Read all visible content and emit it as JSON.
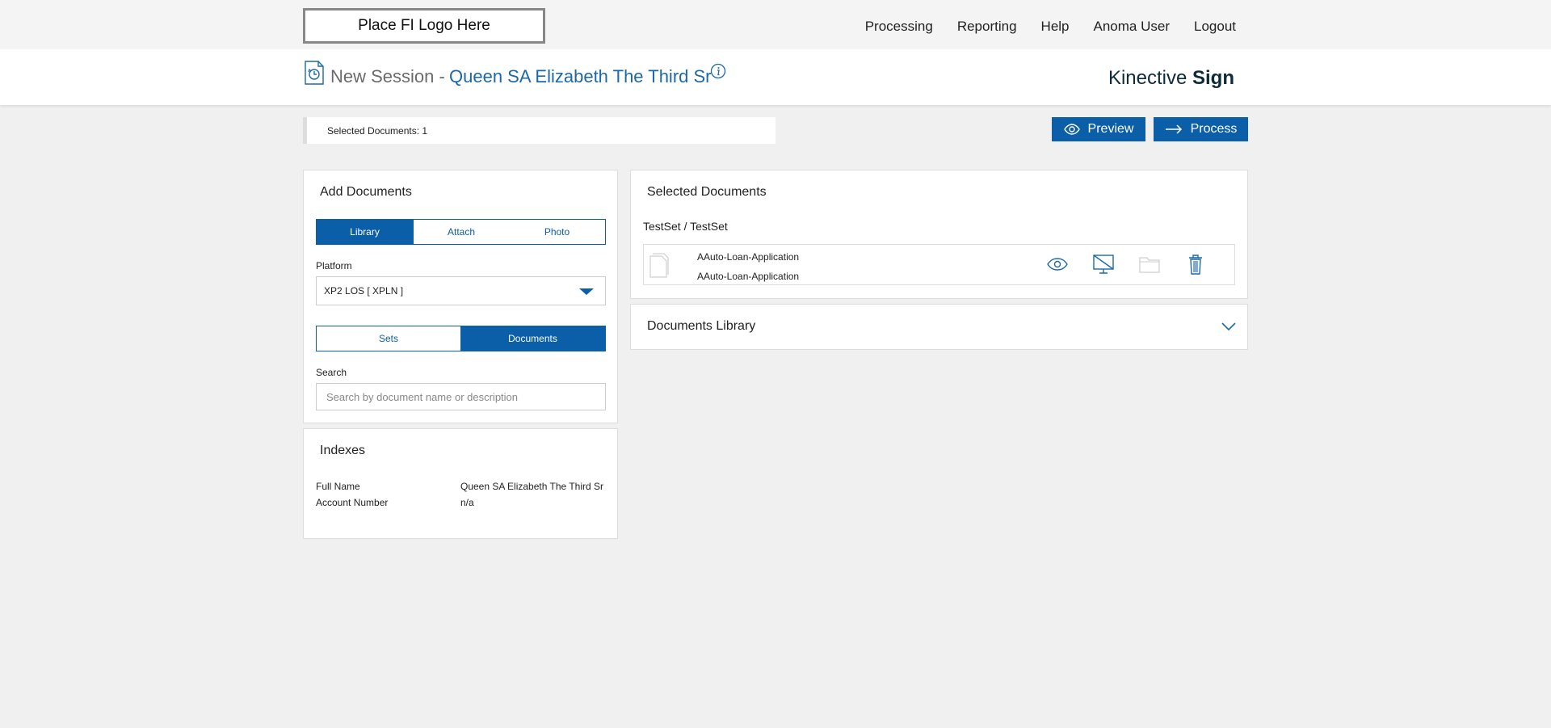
{
  "header": {
    "logo_text": "Place FI Logo Here",
    "nav": [
      "Processing",
      "Reporting",
      "Help",
      "Anoma User",
      "Logout"
    ]
  },
  "session": {
    "title": "New Session -",
    "name": "Queen SA Elizabeth The Third Sr",
    "brand_light": "Kinective",
    "brand_bold": "Sign"
  },
  "toolbar": {
    "selected_count_text": "Selected Documents: 1",
    "preview_label": "Preview",
    "process_label": "Process"
  },
  "add_documents": {
    "title": "Add Documents",
    "source_tabs": [
      "Library",
      "Attach",
      "Photo"
    ],
    "active_source": "Library",
    "platform_label": "Platform",
    "platform_value": "XP2 LOS [ XPLN ]",
    "view_tabs": [
      "Sets",
      "Documents"
    ],
    "active_view": "Documents",
    "search_label": "Search",
    "search_placeholder": "Search by document name or description"
  },
  "indexes": {
    "title": "Indexes",
    "rows": [
      {
        "label": "Full Name",
        "value": "Queen SA Elizabeth The Third Sr"
      },
      {
        "label": "Account Number",
        "value": "n/a"
      }
    ]
  },
  "selected_documents": {
    "title": "Selected Documents",
    "set_name": "TestSet / TestSet",
    "documents": [
      {
        "name": "AAuto-Loan-Application",
        "description": "AAuto-Loan-Application"
      }
    ]
  },
  "documents_library": {
    "title": "Documents Library"
  },
  "colors": {
    "accent": "#0b5ea8",
    "session_name": "#1d69a8",
    "background": "#f0f0f0"
  }
}
